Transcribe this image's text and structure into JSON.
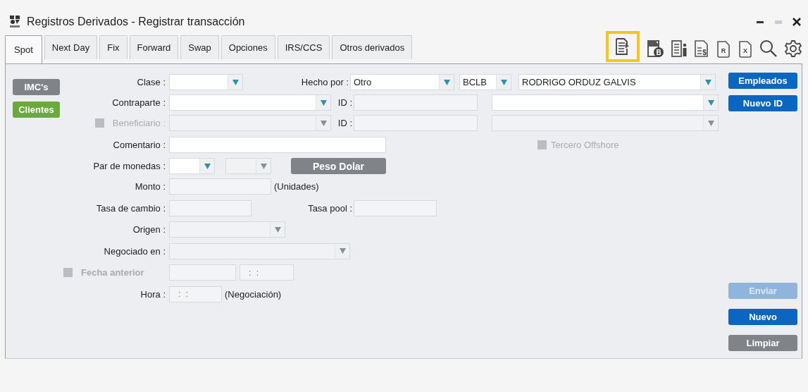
{
  "window": {
    "title": "Registros Derivados - Registrar transacción"
  },
  "tabs": [
    {
      "label": "Spot",
      "selected": true
    },
    {
      "label": "Next Day",
      "selected": false
    },
    {
      "label": "Fix",
      "selected": false
    },
    {
      "label": "Forward",
      "selected": false
    },
    {
      "label": "Swap",
      "selected": false
    },
    {
      "label": "Opciones",
      "selected": false
    },
    {
      "label": "IRS/CCS",
      "selected": false
    },
    {
      "label": "Otros derivados",
      "selected": false
    }
  ],
  "toolbar": [
    {
      "kind": "document-arrow",
      "highlighted": true
    },
    {
      "kind": "document-badge",
      "glyph": "B",
      "highlighted": false
    },
    {
      "kind": "document-person",
      "highlighted": false
    },
    {
      "kind": "document-lines",
      "glyph": "$",
      "highlighted": false
    },
    {
      "kind": "document-letter",
      "glyph": "R",
      "highlighted": false
    },
    {
      "kind": "document-letter",
      "glyph": "X",
      "highlighted": false
    },
    {
      "kind": "search",
      "highlighted": false
    },
    {
      "kind": "settings",
      "highlighted": false
    }
  ],
  "side_buttons": [
    {
      "label": "IMC's",
      "kind": "secondary"
    },
    {
      "label": "Clientes",
      "kind": "success"
    }
  ],
  "form": {
    "clase": {
      "label": "Clase :"
    },
    "hecho_por": {
      "label": "Hecho por :",
      "value": "Otro"
    },
    "codigo": {
      "value": "BCLB"
    },
    "empleado": {
      "value": "RODRIGO ORDUZ GALVIS"
    },
    "contraparte": {
      "label": "Contraparte :",
      "id_label": "ID :"
    },
    "beneficiario": {
      "label": "Beneficiario :",
      "id_label": "ID :",
      "checked": false,
      "disabled": true
    },
    "comentario": {
      "label": "Comentario :"
    },
    "tercero_offshore": {
      "label": "Tercero Offshore",
      "checked": false,
      "disabled": true
    },
    "par_de_monedas": {
      "label": "Par de monedas :",
      "button": "Peso Dolar"
    },
    "monto": {
      "label": "Monto :",
      "unit": "(Unidades)"
    },
    "tasa_de_cambio": {
      "label": "Tasa de cambio :"
    },
    "tasa_pool": {
      "label": "Tasa pool :"
    },
    "origen": {
      "label": "Origen :"
    },
    "negociado_en": {
      "label": "Negociado en :"
    },
    "fecha_anterior": {
      "label": "Fecha anterior",
      "checked": false,
      "disabled": true,
      "placeholder": ": :"
    },
    "hora": {
      "label": "Hora :",
      "placeholder": ": :",
      "note": "(Negociación)"
    }
  },
  "top_buttons": [
    {
      "label": "Empleados",
      "kind": "primary",
      "disabled": false
    },
    {
      "label": "Nuevo ID",
      "kind": "primary",
      "disabled": false
    }
  ],
  "bottom_buttons": [
    {
      "label": "Enviar",
      "kind": "primary",
      "disabled": true
    },
    {
      "label": "Nuevo",
      "kind": "primary",
      "disabled": false
    },
    {
      "label": "Limpiar",
      "kind": "secondary",
      "disabled": false
    }
  ]
}
